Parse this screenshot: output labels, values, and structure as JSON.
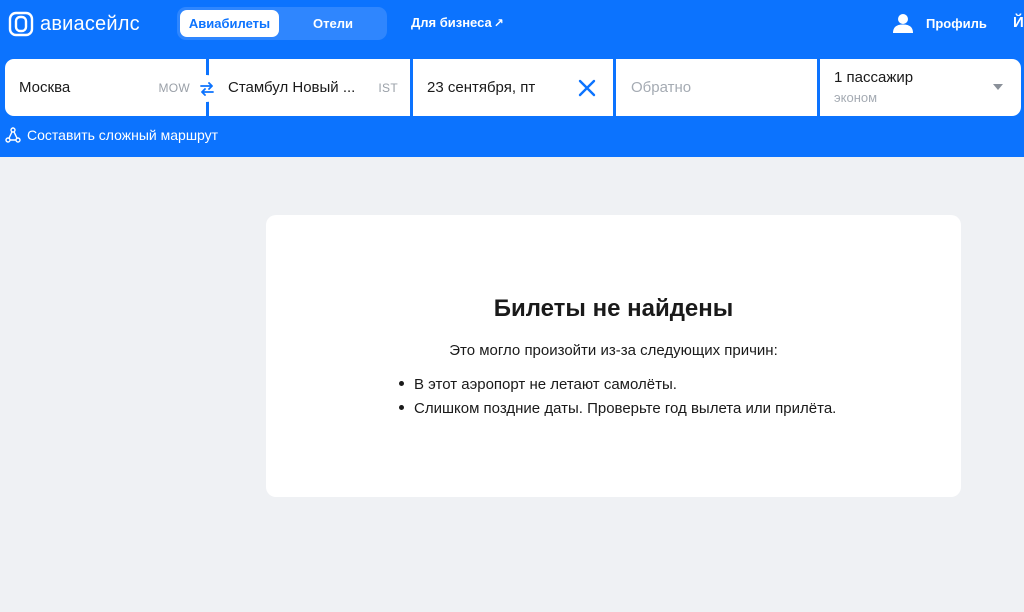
{
  "brand": {
    "name": "авиасейлс"
  },
  "nav": {
    "tabs": [
      {
        "label": "Авиабилеты",
        "active": true
      },
      {
        "label": "Отели",
        "active": false
      }
    ],
    "business_link": "Для бизнеса",
    "business_arrow": "↗",
    "profile_label": "Профиль",
    "cutoff_glyph": "Й"
  },
  "search": {
    "origin": {
      "city": "Москва",
      "code": "MOW"
    },
    "destination": {
      "city": "Стамбул Новый ...",
      "code": "IST"
    },
    "depart_date": "23 сентября, пт",
    "return_placeholder": "Обратно",
    "passengers": "1 пассажир",
    "cabin_class": "эконом",
    "complex_route": "Составить сложный маршрут"
  },
  "result": {
    "title": "Билеты не найдены",
    "subtitle": "Это могло произойти из-за следующих причин:",
    "reasons": [
      "В этот аэропорт не летают самолёты.",
      "Слишком поздние даты. Проверьте год вылета или прилёта."
    ]
  },
  "colors": {
    "brand_blue": "#0c73fe",
    "background": "#eff1f4",
    "card": "#ffffff"
  },
  "icons": {
    "logo": "aviasales-logo-icon",
    "profile": "user-icon",
    "swap": "swap-arrows-icon",
    "clear": "close-icon",
    "route": "route-nodes-icon",
    "dropdown": "chevron-down-icon"
  }
}
